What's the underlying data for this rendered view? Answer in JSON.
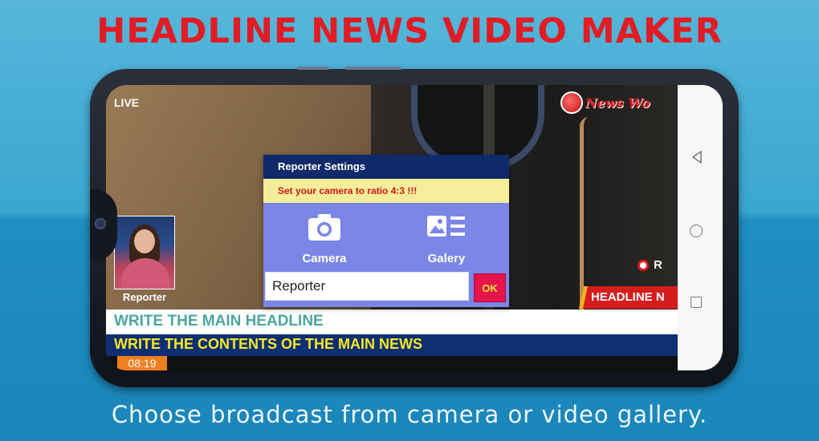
{
  "promo": {
    "title": "HEADLINE NEWS VIDEO MAKER",
    "caption": "Choose broadcast from camera or video gallery."
  },
  "overlay": {
    "live_label": "LIVE",
    "logo_text": "News Wo",
    "rec_label": "R",
    "reporter_caption": "Reporter",
    "headline_tag": "HEADLINE N",
    "headline_text": "WRITE THE MAIN HEADLINE",
    "contents_text": "WRITE THE CONTENTS OF THE MAIN NEWS",
    "time": "08:19"
  },
  "dialog": {
    "title": "Reporter Settings",
    "warning": "Set your camera to ratio 4:3 !!!",
    "camera_label": "Camera",
    "gallery_label": "Galery",
    "name_value": "Reporter",
    "ok_label": "OK"
  },
  "icons": {
    "camera": "camera-icon",
    "gallery": "gallery-icon",
    "globe": "globe-icon",
    "record": "record-icon",
    "back": "back-icon",
    "home": "home-icon",
    "recent": "recent-apps-icon"
  },
  "colors": {
    "title_red": "#e01c24",
    "dialog_header": "#0f2a6a",
    "dialog_body": "#7b86e6",
    "warning_bg": "#f4ee9b",
    "ok_button": "#e6134c",
    "contents_bar": "#0e2f73",
    "contents_text": "#f6e826",
    "headline_text": "#4da5a0",
    "time_box": "#f07f22"
  }
}
